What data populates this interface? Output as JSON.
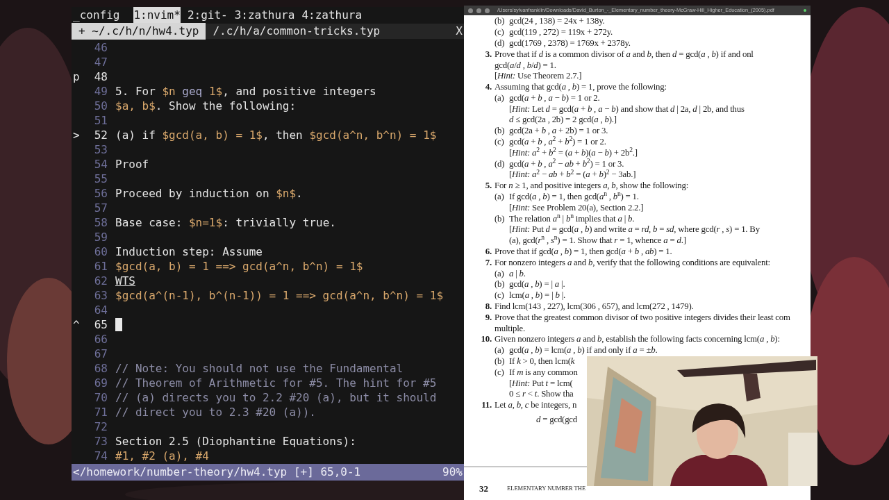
{
  "terminal": {
    "tmux_session": "_config",
    "tmux_windows": [
      {
        "label": "1:nvim*",
        "selected": true
      },
      {
        "label": "2:git-",
        "selected": false
      },
      {
        "label": "3:zathura",
        "selected": false
      },
      {
        "label": "4:zathura",
        "selected": false
      }
    ],
    "buffers": [
      {
        "label": "+ ~/.c/h/n/hw4.typ",
        "selected": true
      },
      {
        "label": "/.c/h/a/common-tricks.typ",
        "selected": false
      }
    ],
    "buffer_close": "X",
    "lines": [
      {
        "number": "46",
        "cursor": false
      },
      {
        "number": "47",
        "cursor": false
      },
      {
        "number": "48",
        "sign": "p",
        "cursor": false
      },
      {
        "number": "49",
        "cursor": false,
        "segments": [
          {
            "text": "5. For ",
            "kind": "text"
          },
          {
            "text": "$n",
            "kind": "math"
          },
          {
            "text": " geq ",
            "kind": "keyword"
          },
          {
            "text": "1$",
            "kind": "math"
          },
          {
            "text": ", and positive integers",
            "kind": "text"
          }
        ]
      },
      {
        "number": "50",
        "cursor": false,
        "segments": [
          {
            "text": "$a, b$",
            "kind": "math"
          },
          {
            "text": ". Show the following:",
            "kind": "text"
          }
        ]
      },
      {
        "number": "51",
        "cursor": false
      },
      {
        "number": "52",
        "sign": ">",
        "cursor": false,
        "segments": [
          {
            "text": "(a) if ",
            "kind": "text"
          },
          {
            "text": "$gcd(a, b) = 1$",
            "kind": "math"
          },
          {
            "text": ", then ",
            "kind": "text"
          },
          {
            "text": "$gcd(a^n, b^n) = 1$",
            "kind": "math"
          }
        ]
      },
      {
        "number": "53",
        "cursor": false
      },
      {
        "number": "54",
        "cursor": false,
        "segments": [
          {
            "text": "Proof",
            "kind": "text"
          }
        ]
      },
      {
        "number": "55",
        "cursor": false
      },
      {
        "number": "56",
        "cursor": false,
        "segments": [
          {
            "text": "Proceed by induction on ",
            "kind": "text"
          },
          {
            "text": "$n$",
            "kind": "math"
          },
          {
            "text": ".",
            "kind": "text"
          }
        ]
      },
      {
        "number": "57",
        "cursor": false
      },
      {
        "number": "58",
        "cursor": false,
        "segments": [
          {
            "text": "Base case: ",
            "kind": "text"
          },
          {
            "text": "$n=1$",
            "kind": "math"
          },
          {
            "text": ": trivially true.",
            "kind": "text"
          }
        ]
      },
      {
        "number": "59",
        "cursor": false
      },
      {
        "number": "60",
        "cursor": false,
        "segments": [
          {
            "text": "Induction step: Assume",
            "kind": "text"
          }
        ]
      },
      {
        "number": "61",
        "cursor": false,
        "segments": [
          {
            "text": "$gcd(a, b) = 1 ==> gcd(a^n, b^n) = 1$",
            "kind": "math"
          }
        ]
      },
      {
        "number": "62",
        "cursor": false,
        "segments": [
          {
            "text": "WTS",
            "kind": "underline"
          }
        ]
      },
      {
        "number": "63",
        "cursor": false,
        "segments": [
          {
            "text": "$gcd(a^(n-1), b^(n-1)) = 1 ==> gcd(a^n, b^n) = 1$",
            "kind": "math"
          }
        ]
      },
      {
        "number": "64",
        "cursor": false
      },
      {
        "number": "65",
        "sign": "^",
        "cursor": true
      },
      {
        "number": "66",
        "cursor": false
      },
      {
        "number": "67",
        "cursor": false
      },
      {
        "number": "68",
        "cursor": false,
        "segments": [
          {
            "text": "// Note: You should not use the Fundamental",
            "kind": "comment"
          }
        ]
      },
      {
        "number": "69",
        "cursor": false,
        "segments": [
          {
            "text": "// Theorem of Arithmetic for #5. The hint for #5",
            "kind": "comment"
          }
        ]
      },
      {
        "number": "70",
        "cursor": false,
        "segments": [
          {
            "text": "// (a) directs you to 2.2 #20 (a), but it should",
            "kind": "comment"
          }
        ]
      },
      {
        "number": "71",
        "cursor": false,
        "segments": [
          {
            "text": "// direct you to 2.3 #20 (a)).",
            "kind": "comment"
          }
        ]
      },
      {
        "number": "72",
        "cursor": false
      },
      {
        "number": "73",
        "cursor": false,
        "segments": [
          {
            "text": "Section 2.5 (Diophantine Equations):",
            "kind": "text"
          }
        ]
      },
      {
        "number": "74",
        "cursor": false,
        "segments": [
          {
            "text": "#1, #2 (a), #4",
            "kind": "math"
          }
        ]
      }
    ],
    "status": {
      "path": "</homework/number-theory/hw4.typ [+] 65,0-1",
      "percent": "90%"
    }
  },
  "pdf_viewer": {
    "title": "/Users/sylvanfranklin/Downloads/David_Burton_-_Elementary_number_theory-McGraw-Hill_Higher_Education_(2005).pdf",
    "lines": [
      {
        "kind": "part",
        "label": "(b)",
        "text": "gcd(24 , 138) = 24x + 138y."
      },
      {
        "kind": "part",
        "label": "(c)",
        "text": "gcd(119 , 272) = 119x + 272y."
      },
      {
        "kind": "part",
        "label": "(d)",
        "text": "gcd(1769 , 2378) = 1769x + 2378y."
      },
      {
        "kind": "problem",
        "label": "3.",
        "text": "Prove that if *d* is a common divisor of *a* and *b*, then *d* = gcd(*a* , *b*) if and onl"
      },
      {
        "kind": "cont",
        "text": "gcd(*a*/*d* , *b*/*d*) = 1."
      },
      {
        "kind": "cont",
        "text": "[*Hint:* Use Theorem 2.7.]"
      },
      {
        "kind": "problem",
        "label": "4.",
        "text": "Assuming that gcd(*a* , *b*) = 1, prove the following:"
      },
      {
        "kind": "part",
        "label": "(a)",
        "text": "gcd(*a* + *b* , *a* − *b*) = 1 or 2."
      },
      {
        "kind": "part_cont",
        "text": "[*Hint:* Let *d* = gcd(*a* + *b* , *a* − *b*) and show that *d* | 2a, *d* | 2b, and thus"
      },
      {
        "kind": "part_cont",
        "text": "*d* ≤ gcd(2a , 2b) = 2 gcd(*a* , *b*).]"
      },
      {
        "kind": "part",
        "label": "(b)",
        "text": "gcd(2a + *b* , *a* + 2b) = 1 or 3."
      },
      {
        "kind": "part",
        "label": "(c)",
        "text": "gcd(*a* + *b* , *a*$^{2}$ + *b*$^{2}$) = 1 or 2."
      },
      {
        "kind": "part_cont",
        "text": "[*Hint:* *a*$^{2}$ + *b*$^{2}$ = (*a* + *b*)(*a* − *b*) + 2b$^{2}$.]"
      },
      {
        "kind": "part",
        "label": "(d)",
        "text": "gcd(*a* + *b* , *a*$^{2}$ − *ab* + *b*$^{2}$) = 1 or 3."
      },
      {
        "kind": "part_cont",
        "text": "[*Hint:* *a*$^{2}$ − *ab* + *b*$^{2}$ = (*a* + *b*)$^{2}$ − 3ab.]"
      },
      {
        "kind": "problem",
        "label": "5.",
        "text": "For *n* ≥ 1, and positive integers *a*, *b*, show the following:"
      },
      {
        "kind": "part",
        "label": "(a)",
        "text": "If gcd(*a* , *b*) = 1, then gcd(*a*$^{n}$ , *b*$^{n}$) = 1."
      },
      {
        "kind": "part_cont",
        "text": "[*Hint:* See Problem 20(a), Section 2.2.]"
      },
      {
        "kind": "part",
        "label": "(b)",
        "text": "The relation *a*$^{n}$ | *b*$^{n}$ implies that *a* | *b*."
      },
      {
        "kind": "part_cont",
        "text": "[*Hint:* Put *d* = gcd(*a* , *b*) and write *a* = *rd*, *b* = *sd*, where gcd(*r* , *s*) = 1. By"
      },
      {
        "kind": "part_cont",
        "text": "(a), gcd(*r*$^{n}$ , *s*$^{n}$) = 1. Show that *r* = 1, whence *a* = *d*.]"
      },
      {
        "kind": "problem",
        "label": "6.",
        "text": "Prove that if gcd(*a* , *b*) = 1, then gcd(*a* + *b* , *ab*) = 1."
      },
      {
        "kind": "problem",
        "label": "7.",
        "text": "For nonzero integers *a* and *b*, verify that the following conditions are equivalent:"
      },
      {
        "kind": "part",
        "label": "(a)",
        "text": "*a* | *b*."
      },
      {
        "kind": "part",
        "label": "(b)",
        "text": "gcd(*a* , *b*) = | *a* |."
      },
      {
        "kind": "part",
        "label": "(c)",
        "text": "lcm(*a* , *b*) = | *b* |."
      },
      {
        "kind": "problem",
        "label": "8.",
        "text": "Find lcm(143 , 227), lcm(306 , 657), and lcm(272 , 1479)."
      },
      {
        "kind": "problem",
        "label": "9.",
        "text": "Prove that the greatest common divisor of two positive integers divides their least com"
      },
      {
        "kind": "cont",
        "text": "multiple."
      },
      {
        "kind": "problem",
        "label": "10.",
        "text": "Given nonzero integers *a* and *b*, establish the following facts concerning lcm(*a* , *b*):"
      },
      {
        "kind": "part",
        "label": "(a)",
        "text": "gcd(*a* , *b*) = lcm(*a* , *b*) if and only if *a* = ±*b*."
      },
      {
        "kind": "part",
        "label": "(b)",
        "text": "If *k* > 0, then lcm(*k*"
      },
      {
        "kind": "part",
        "label": "(c)",
        "text": "If *m* is any common"
      },
      {
        "kind": "part_cont",
        "text": "[*Hint:* Put *t* = lcm("
      },
      {
        "kind": "part_cont",
        "text": "0 ≤ *r* < *t*. Show tha"
      },
      {
        "kind": "problem",
        "label": "11.",
        "text": "Let *a*, *b*, *c* be integers, n"
      },
      {
        "kind": "display",
        "text": "*d* = gcd(gcd"
      }
    ],
    "page_number": "32",
    "running_head": "ELEMENTARY NUMBER THE"
  }
}
